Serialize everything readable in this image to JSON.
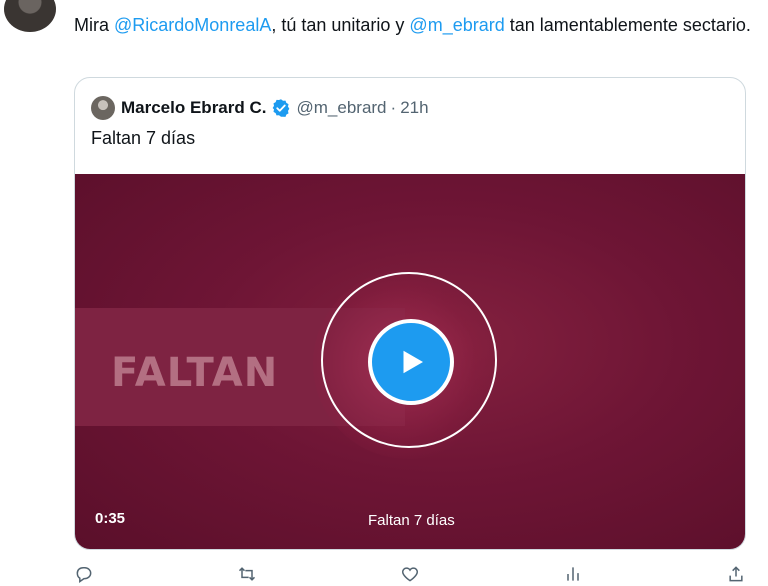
{
  "tweet": {
    "text_prefix": "Mira ",
    "mention_1": "@RicardoMonrealA",
    "text_middle": ", tú tan unitario y ",
    "mention_2": "@m_ebrard",
    "text_suffix": " tan lamentablemente sectario."
  },
  "quoted_tweet": {
    "name": "Marcelo Ebrard C.",
    "handle": "@m_ebrard",
    "separator": "·",
    "time": "21h",
    "text": "Faltan 7 días",
    "video": {
      "overlay_text": "FALTAN",
      "duration": "0:35",
      "caption": "Faltan 7 días"
    }
  },
  "colors": {
    "link": "#1d9bf0",
    "video_bg": "#6e1535",
    "play_button": "#1d9bf0"
  },
  "icons": [
    "reply-icon",
    "retweet-icon",
    "like-icon",
    "views-icon",
    "verified-badge-icon",
    "play-icon"
  ]
}
